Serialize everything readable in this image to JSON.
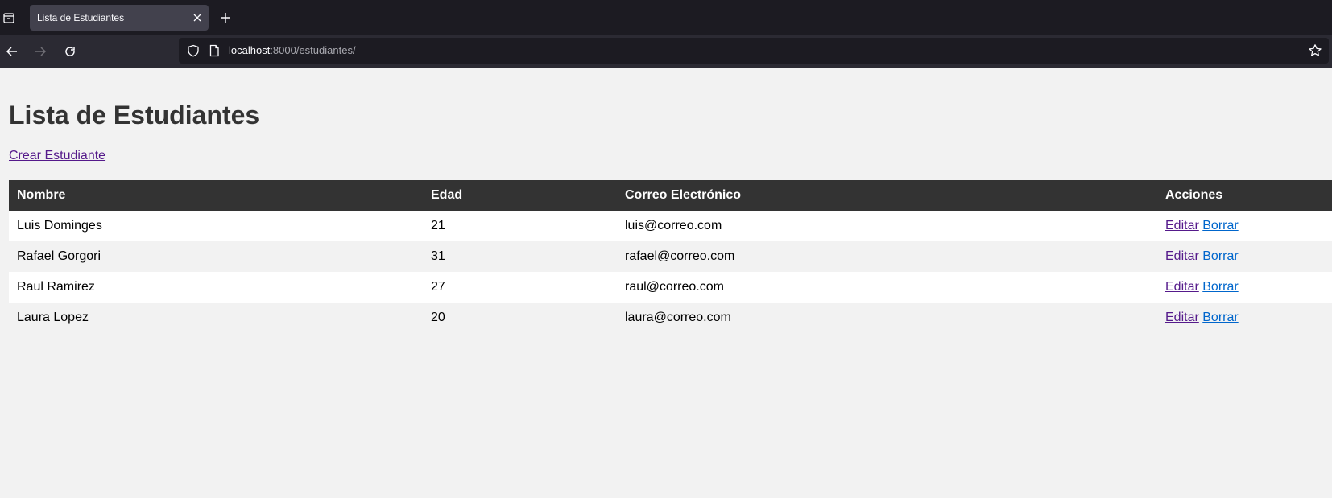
{
  "browser": {
    "tab_title": "Lista de Estudiantes",
    "url_host": "localhost",
    "url_rest": ":8000/estudiantes/"
  },
  "page": {
    "title": "Lista de Estudiantes",
    "create_link": "Crear Estudiante"
  },
  "table": {
    "headers": [
      "Nombre",
      "Edad",
      "Correo Electrónico",
      "Acciones"
    ],
    "rows": [
      {
        "name": "Luis Dominges",
        "age": "21",
        "email": "luis@correo.com",
        "edit": "Editar",
        "delete": "Borrar"
      },
      {
        "name": "Rafael Gorgori",
        "age": "31",
        "email": "rafael@correo.com",
        "edit": "Editar",
        "delete": "Borrar"
      },
      {
        "name": "Raul Ramirez",
        "age": "27",
        "email": "raul@correo.com",
        "edit": "Editar",
        "delete": "Borrar"
      },
      {
        "name": "Laura Lopez",
        "age": "20",
        "email": "laura@correo.com",
        "edit": "Editar",
        "delete": "Borrar"
      }
    ]
  },
  "colors": {
    "header_bg": "#333333",
    "visited_link": "#551a8b",
    "link": "#0066cc"
  }
}
